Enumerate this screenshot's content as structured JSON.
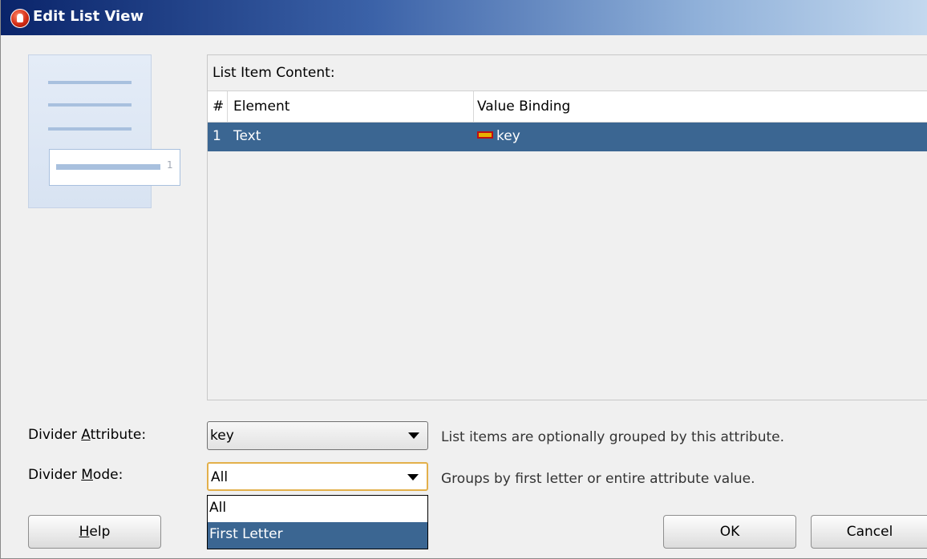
{
  "window": {
    "title": "Edit List View"
  },
  "preview": {
    "item_number": "1"
  },
  "list_content": {
    "label": "List Item Content:",
    "columns": [
      "#",
      "Element",
      "Value Binding"
    ],
    "rows": [
      {
        "index": "1",
        "element": "Text",
        "value_binding": "key",
        "binding_icon": "attribute-icon",
        "selected": true
      }
    ]
  },
  "divider_attribute": {
    "label": "Divider Attribute:",
    "value": "key",
    "hint": "List items are optionally grouped by this attribute."
  },
  "divider_mode": {
    "label": "Divider Mode:",
    "value": "All",
    "hint": "Groups by first letter or entire attribute value.",
    "options": [
      "All",
      "First Letter"
    ],
    "highlighted_option": "First Letter"
  },
  "buttons": {
    "help": "Help",
    "ok": "OK",
    "cancel": "Cancel"
  },
  "colors": {
    "selection": "#3b6692",
    "focus_border": "#e3b04b",
    "title_gradient_start": "#0a246a"
  }
}
